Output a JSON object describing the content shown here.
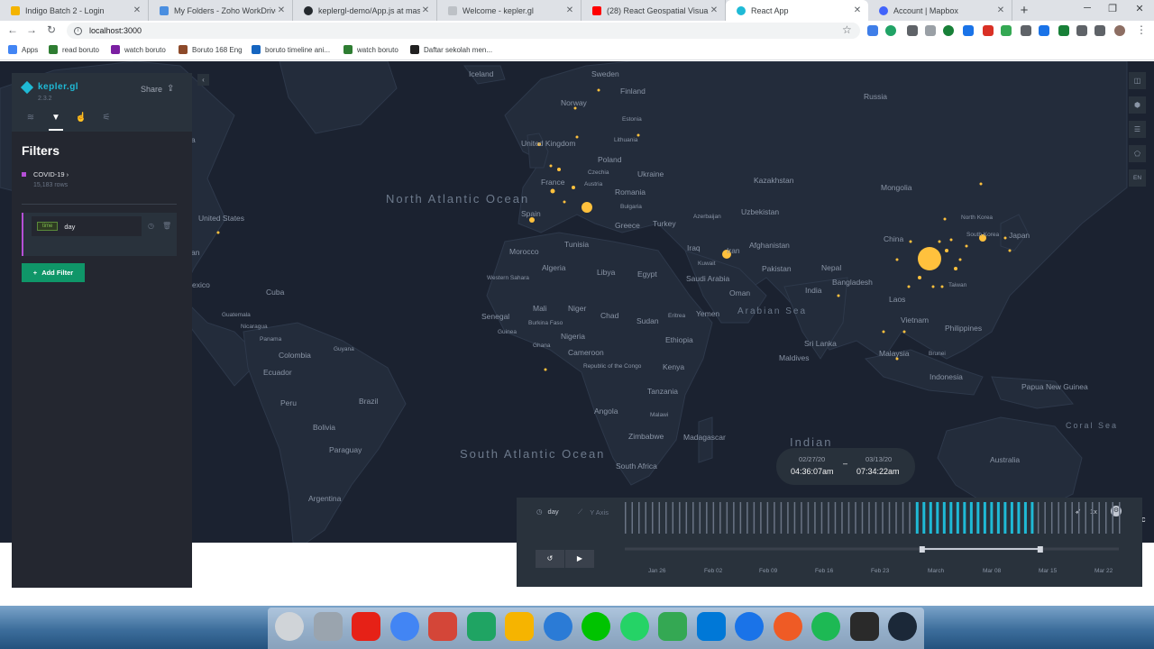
{
  "browser": {
    "tabs": [
      {
        "title": "Indigo Batch 2 - Login",
        "color": "#f4b400"
      },
      {
        "title": "My Folders - Zoho WorkDrive",
        "color": "#4a8ee0"
      },
      {
        "title": "keplergl-demo/App.js at master",
        "color": "#24292e"
      },
      {
        "title": "Welcome - kepler.gl",
        "color": "#bdc1c6"
      },
      {
        "title": "(28) React Geospatial Visualizatio",
        "color": "#ff0000"
      },
      {
        "title": "React App",
        "color": "#1fbad6"
      },
      {
        "title": "Account | Mapbox",
        "color": "#4264fb"
      }
    ],
    "new_tab": "+",
    "url": "localhost:3000",
    "bookmarks": [
      {
        "label": "Apps",
        "color": "#4285f4"
      },
      {
        "label": "read boruto",
        "color": "#2e7d32"
      },
      {
        "label": "watch boruto",
        "color": "#7b1fa2"
      },
      {
        "label": "Boruto 168 Eng",
        "color": "#8d4a2a"
      },
      {
        "label": "boruto timeline ani...",
        "color": "#1565c0"
      },
      {
        "label": "watch boruto",
        "color": "#2e7d32"
      },
      {
        "label": "Daftar sekolah men...",
        "color": "#212121"
      }
    ]
  },
  "panel": {
    "logo": "kepler.gl",
    "version": "2.3.2",
    "share": "Share",
    "tabs": [
      "layers-icon",
      "filter-icon",
      "interaction-icon",
      "settings-icon"
    ],
    "title": "Filters",
    "dataset": {
      "name": "COVID-19",
      "rows": "15,183 rows",
      "color": "#b54fd6"
    },
    "filter": {
      "type": "time",
      "field": "day"
    },
    "add_filter": "Add Filter"
  },
  "map": {
    "labels": {
      "iceland": "Iceland",
      "sweden": "Sweden",
      "finland": "Finland",
      "russia": "Russia",
      "norway": "Norway",
      "estonia": "Estonia",
      "uk": "United Kingdom",
      "lithuania": "Lithuania",
      "poland": "Poland",
      "czechia": "Czechia",
      "austria": "Austria",
      "ukraine": "Ukraine",
      "france": "France",
      "romania": "Romania",
      "kazakhstan": "Kazakhstan",
      "mongolia": "Mongolia",
      "bulgaria": "Bulgaria",
      "spain": "Spain",
      "azerbaijan": "Azerbaijan",
      "uzbekistan": "Uzbekistan",
      "turkey": "Turkey",
      "greece": "Greece",
      "north_korea": "North Korea",
      "south_korea": "South Korea",
      "japan": "Japan",
      "china": "China",
      "tunisia": "Tunisia",
      "iraq": "Iraq",
      "iran": "Iran",
      "afghanistan": "Afghanistan",
      "morocco": "Morocco",
      "kuwait": "Kuwait",
      "pakistan": "Pakistan",
      "nepal": "Nepal",
      "algeria": "Algeria",
      "libya": "Libya",
      "egypt": "Egypt",
      "saudi": "Saudi Arabia",
      "bangladesh": "Bangladesh",
      "taiwan": "Taiwan",
      "western_sahara": "Western Sahara",
      "oman": "Oman",
      "india": "India",
      "laos": "Laos",
      "mali": "Mali",
      "niger": "Niger",
      "chad": "Chad",
      "sudan": "Sudan",
      "eritrea": "Eritrea",
      "yemen": "Yemen",
      "senegal": "Senegal",
      "burkina": "Burkina Faso",
      "vietnam": "Vietnam",
      "philippines": "Philippines",
      "guinea": "Guinea",
      "nigeria": "Nigeria",
      "ethiopia": "Ethiopia",
      "ghana": "Ghana",
      "cameroon": "Cameroon",
      "sri_lanka": "Sri Lanka",
      "maldives": "Maldives",
      "malaysia": "Malaysia",
      "brunei": "Brunei",
      "congo": "Republic of the Congo",
      "kenya": "Kenya",
      "indonesia": "Indonesia",
      "tanzania": "Tanzania",
      "png": "Papua New Guinea",
      "angola": "Angola",
      "malawi": "Malawi",
      "zimbabwe": "Zimbabwe",
      "madagascar": "Madagascar",
      "south_africa": "South Africa",
      "australia": "Australia",
      "us": "United States",
      "mexico": "exico",
      "cuba": "Cuba",
      "guatemala": "Guatemala",
      "nicaragua": "Nicaragua",
      "panama": "Panama",
      "colombia": "Colombia",
      "guyana": "Guyana",
      "ecuador": "Ecuador",
      "peru": "Peru",
      "brazil": "Brazil",
      "bolivia": "Bolivia",
      "paraguay": "Paraguay",
      "argentina": "Argentina",
      "edge_a": "a",
      "edge_an": "an"
    },
    "oceans": {
      "north_atlantic": "North Atlantic Ocean",
      "arabian": "Arabian Sea",
      "indian": "Indian",
      "south_atlantic": "South Atlantic Ocean",
      "coral": "Coral Sea"
    },
    "point_color": "#ffc13d",
    "controls": [
      "split-map-icon",
      "3d-map-icon",
      "legend-icon",
      "draw-polygon-icon",
      "EN"
    ]
  },
  "time_range": {
    "start_date": "02/27/20",
    "start_time": "04:36:07am",
    "end_date": "03/13/20",
    "end_time": "07:34:22am",
    "separator": "–"
  },
  "timeline": {
    "field": "day",
    "y_axis": "Y Axis",
    "speed": "1x",
    "tick_labels": [
      "Jan 26",
      "Feb 02",
      "Feb 09",
      "Feb 16",
      "Feb 23",
      "March",
      "Mar 08",
      "Mar 15",
      "Mar 22"
    ],
    "selected_fraction": [
      0.58,
      0.83
    ],
    "bar_count": 74,
    "selected_color": "#1fbad6",
    "bar_color": "#6a7485"
  },
  "cut_text": "c",
  "dock": [
    {
      "name": "clock-app",
      "color": "#d0d4d8"
    },
    {
      "name": "trash-app",
      "color": "#9aa4ae"
    },
    {
      "name": "youtube-app",
      "color": "#e62117"
    },
    {
      "name": "chrome-app",
      "color": "#4285f4"
    },
    {
      "name": "gmail-app",
      "color": "#d44638"
    },
    {
      "name": "drive-app",
      "color": "#1fa463"
    },
    {
      "name": "keep-app",
      "color": "#f6b400"
    },
    {
      "name": "earth-app",
      "color": "#2b7bd6"
    },
    {
      "name": "line-app",
      "color": "#00c300"
    },
    {
      "name": "whatsapp-app",
      "color": "#25d366"
    },
    {
      "name": "maps-app",
      "color": "#34a853"
    },
    {
      "name": "vscode-app",
      "color": "#0078d7"
    },
    {
      "name": "location-app",
      "color": "#1a73e8"
    },
    {
      "name": "postman-app",
      "color": "#ef5b25"
    },
    {
      "name": "spotify-app",
      "color": "#1db954"
    },
    {
      "name": "epic-games-app",
      "color": "#2a2a2a"
    },
    {
      "name": "steam-app",
      "color": "#1b2838"
    }
  ]
}
